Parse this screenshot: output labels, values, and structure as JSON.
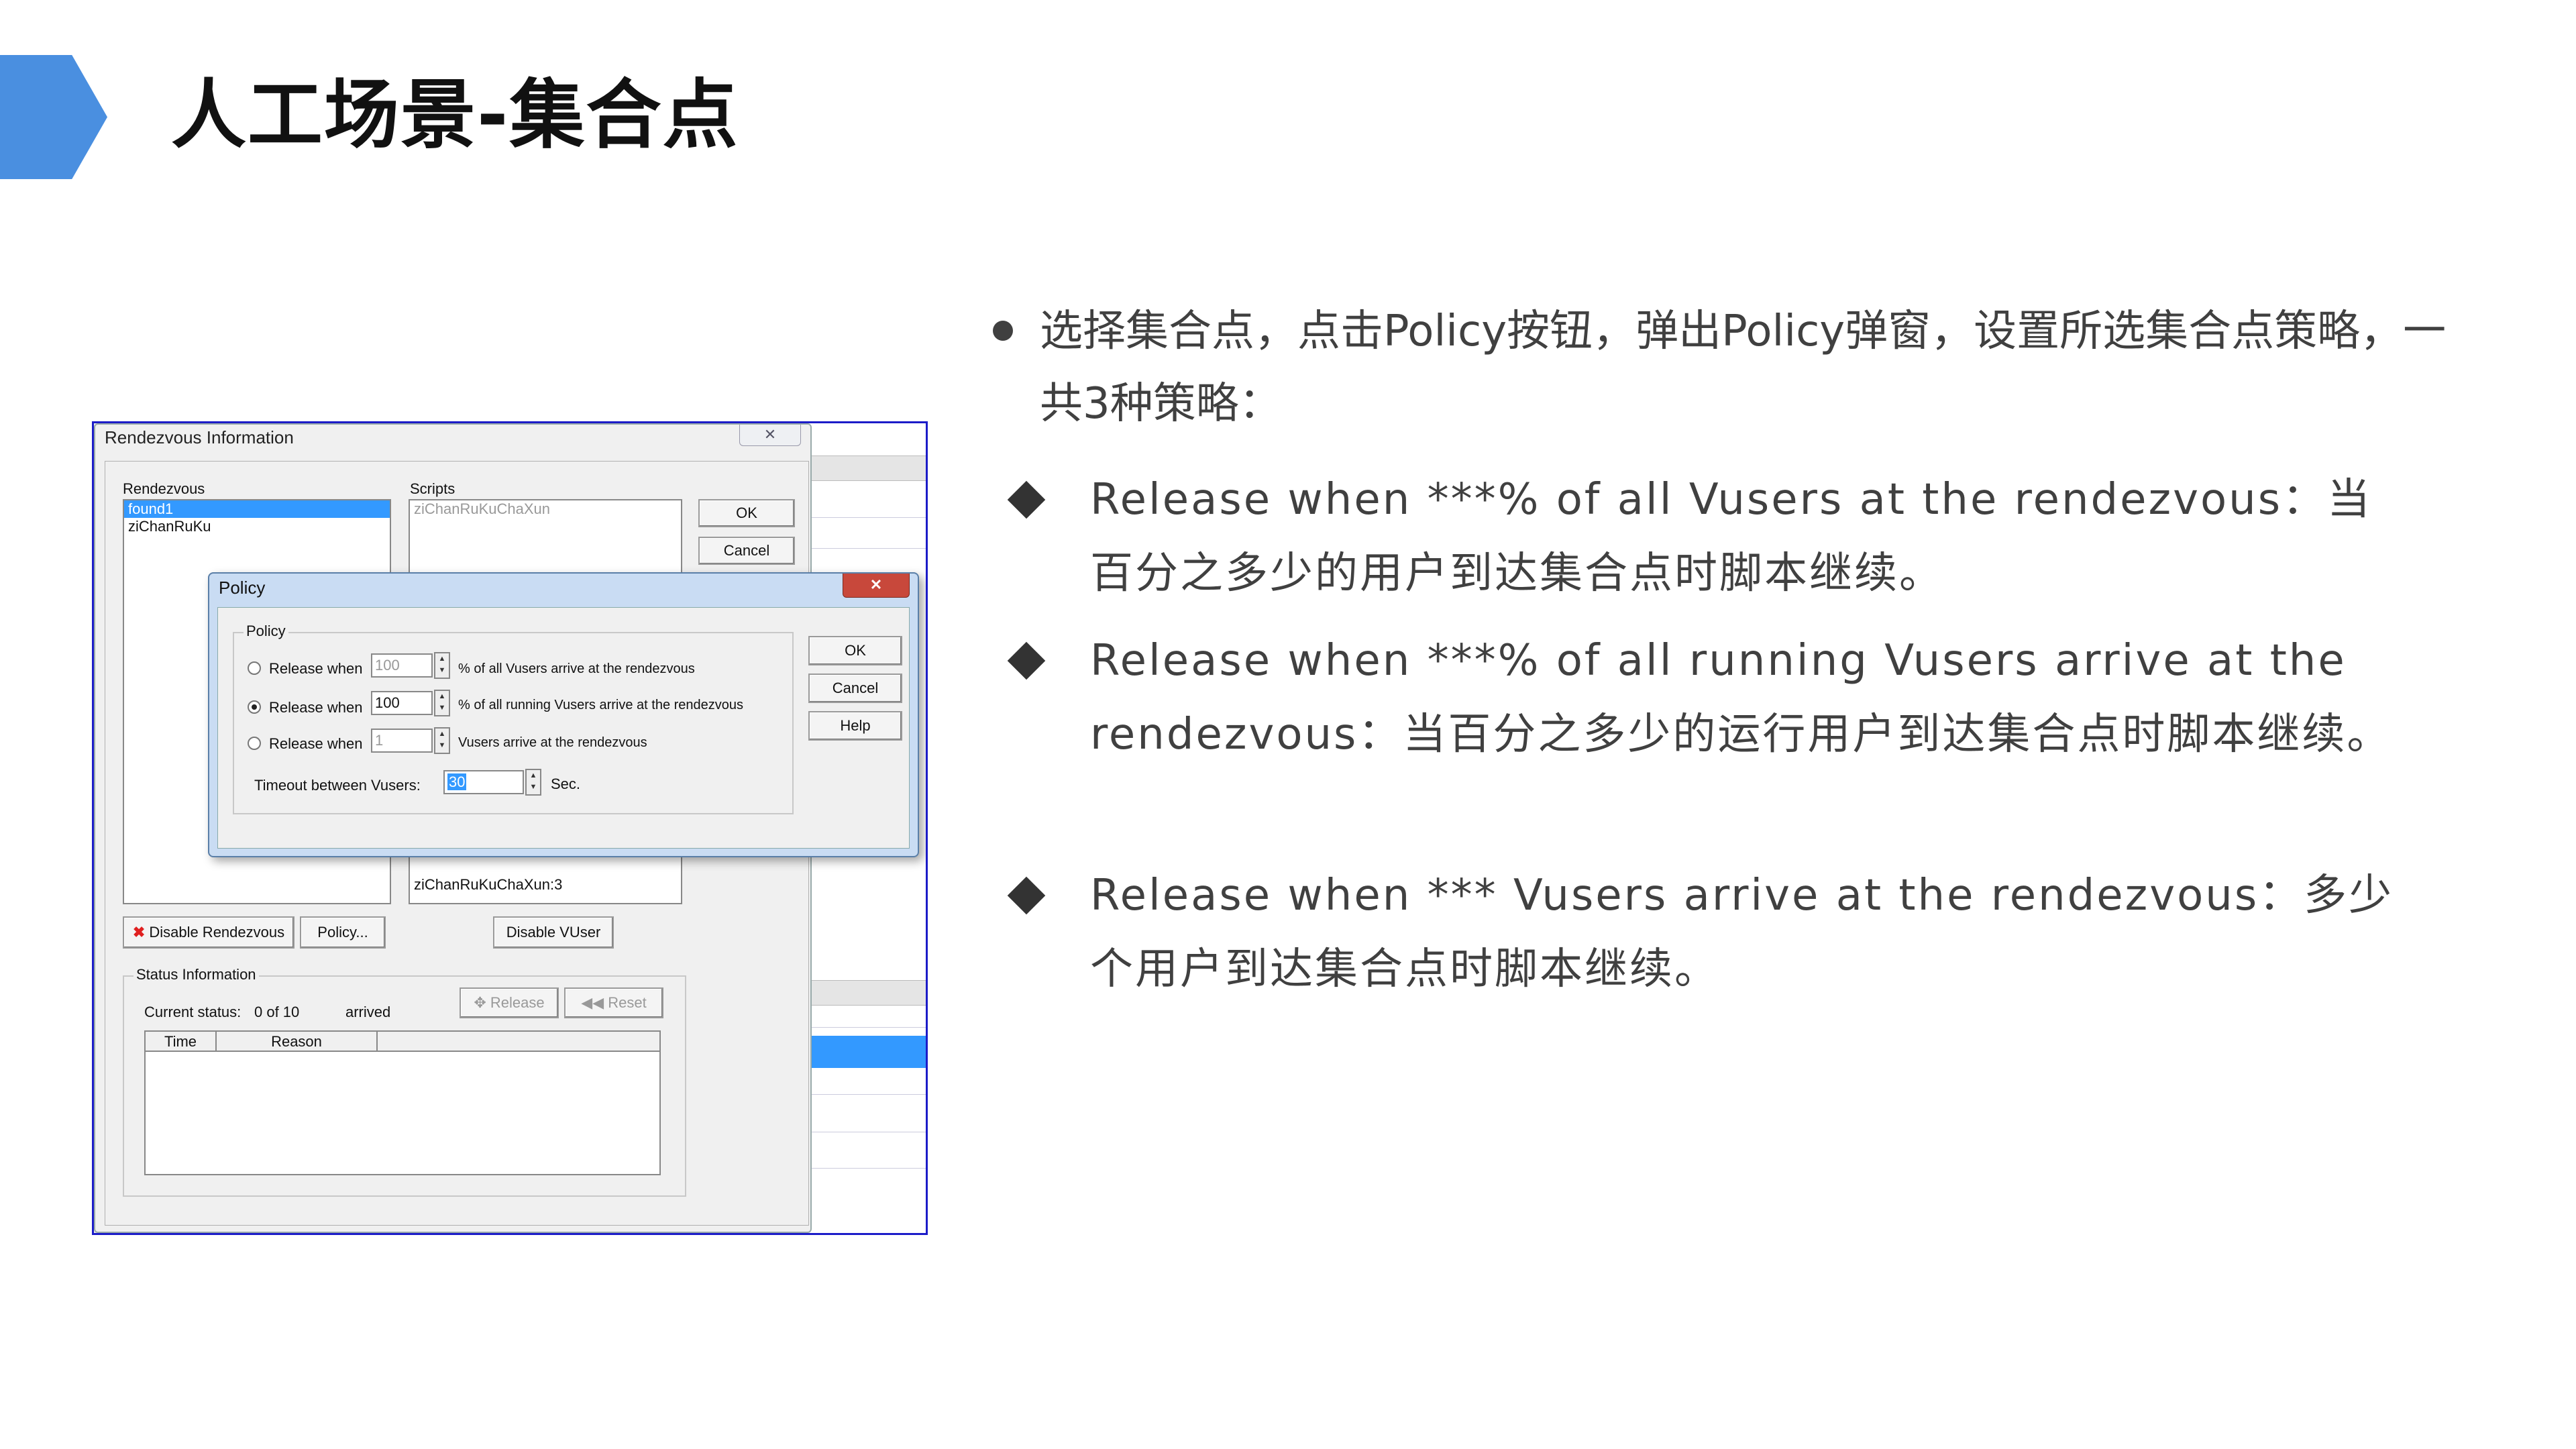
{
  "slide": {
    "title": "人工场景-集合点",
    "bullet_main": "选择集合点，点击Policy按钮，弹出Policy弹窗，设置所选集合点策略，一共3种策略：",
    "sub_bullets": [
      "Release when ***% of all Vusers at the rendezvous：当百分之多少的用户到达集合点时脚本继续。",
      "Release when ***% of all running Vusers arrive at the rendezvous：当百分之多少的运行用户到达集合点时脚本继续。",
      "Release when *** Vusers arrive at the rendezvous：多少个用户到达集合点时脚本继续。"
    ]
  },
  "rendezvous_window": {
    "title": "Rendezvous Information",
    "close_glyph": "✕",
    "rendezvous_label": "Rendezvous",
    "rendezvous_items": [
      "found1",
      "ziChanRuKu"
    ],
    "scripts_label": "Scripts",
    "scripts_items": [
      "ziChanRuKuChaXun"
    ],
    "scripts_item_bottom": "ziChanRuKuChaXun:3",
    "ok_label": "OK",
    "cancel_label": "Cancel",
    "disable_rendezvous_label": "Disable Rendezvous",
    "policy_button_label": "Policy...",
    "disable_vuser_label": "Disable VUser",
    "status_group_label": "Status Information",
    "current_status_label": "Current status:",
    "current_status_value": "0 of 10",
    "arrived_label": "arrived",
    "release_label": "Release",
    "reset_label": "Reset",
    "columns": [
      "Time",
      "Reason"
    ]
  },
  "policy_dialog": {
    "title": "Policy",
    "close_glyph": "✕",
    "group_label": "Policy",
    "options": [
      {
        "label": "Release when",
        "value": "100",
        "suffix": "% of all Vusers arrive at the rendezvous",
        "checked": false
      },
      {
        "label": "Release when",
        "value": "100",
        "suffix": "% of all running Vusers arrive at the rendezvous",
        "checked": true
      },
      {
        "label": "Release when",
        "value": "1",
        "suffix": "Vusers arrive at the rendezvous",
        "checked": false
      }
    ],
    "timeout_label": "Timeout between Vusers:",
    "timeout_value": "30",
    "timeout_unit": "Sec.",
    "ok_label": "OK",
    "cancel_label": "Cancel",
    "help_label": "Help"
  },
  "colors": {
    "accent": "#4a8fe0",
    "selection": "#3399ff",
    "close_red": "#c8483b"
  }
}
